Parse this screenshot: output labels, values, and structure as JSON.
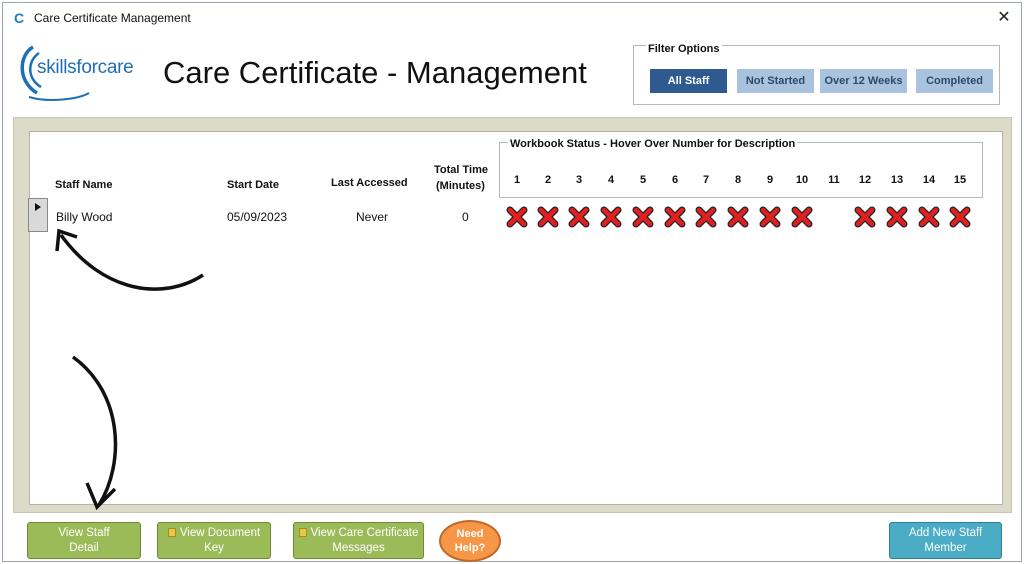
{
  "window": {
    "title": "Care Certificate Management",
    "app_icon": "C"
  },
  "logo": {
    "text": "skillsforcare"
  },
  "heading": "Care Certificate - Management",
  "filter": {
    "title": "Filter Options",
    "buttons": [
      {
        "label": "All Staff",
        "active": true
      },
      {
        "label": "Not Started",
        "active": false
      },
      {
        "label": "Over 12 Weeks",
        "active": false
      },
      {
        "label": "Completed",
        "active": false
      }
    ]
  },
  "table": {
    "headers": {
      "staff_name": "Staff Name",
      "start_date": "Start Date",
      "last_accessed": "Last Accessed",
      "total_time_1": "Total Time",
      "total_time_2": "(Minutes)"
    },
    "workbook_title": "Workbook Status - Hover Over Number for Description",
    "workbook_numbers": [
      "1",
      "2",
      "3",
      "4",
      "5",
      "6",
      "7",
      "8",
      "9",
      "10",
      "11",
      "12",
      "13",
      "14",
      "15"
    ],
    "rows": [
      {
        "staff_name": "Billy Wood",
        "start_date": "05/09/2023",
        "last_accessed": "Never",
        "total_time": "0",
        "status": [
          "x",
          "x",
          "x",
          "x",
          "x",
          "x",
          "x",
          "x",
          "x",
          "x",
          "",
          "x",
          "x",
          "x",
          "x"
        ]
      }
    ]
  },
  "buttons": {
    "view_staff_1": "View Staff",
    "view_staff_2": "Detail",
    "view_doc_1": "View Document",
    "view_doc_2": "Key",
    "view_msg_1": "View Care Certificate",
    "view_msg_2": "Messages",
    "help_1": "Need",
    "help_2": "Help?",
    "add_staff_1": "Add New Staff",
    "add_staff_2": "Member"
  },
  "colors": {
    "filter_active": "#2f5a8f",
    "filter_inactive": "#a9c3de",
    "button_green": "#9bbb59",
    "button_teal": "#4bacc6",
    "button_orange": "#f79646",
    "status_x": "#e02020"
  }
}
